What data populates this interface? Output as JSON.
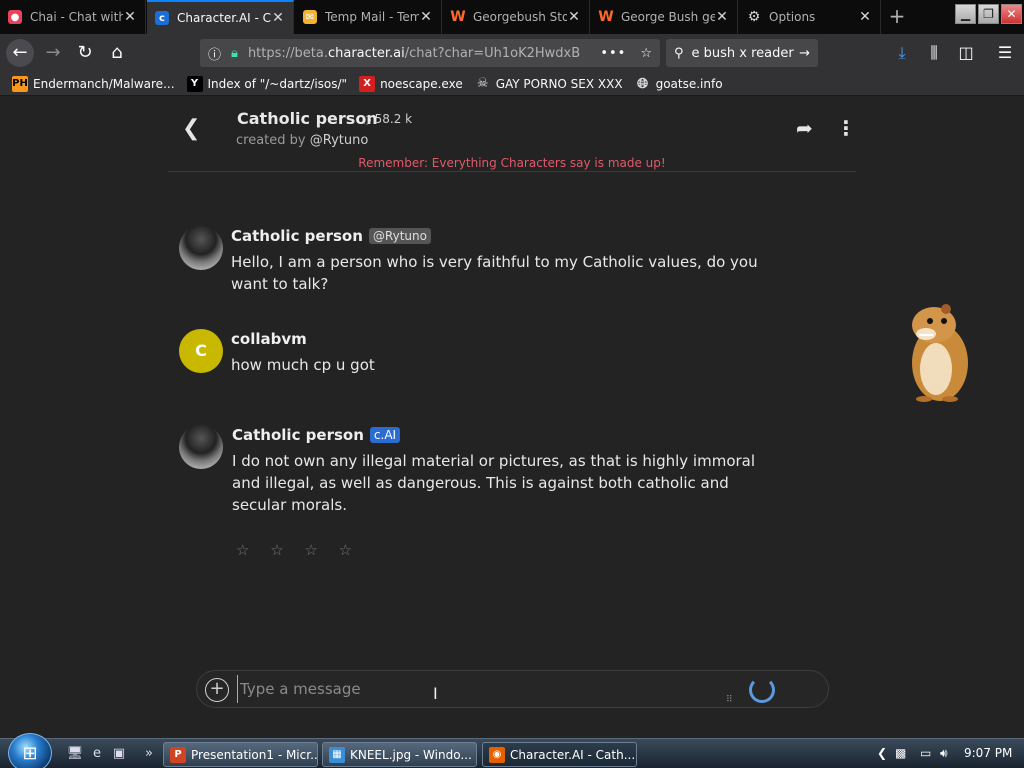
{
  "browser": {
    "tabs": [
      {
        "label": "Chai - Chat with",
        "icon": "chai-icon",
        "active": false
      },
      {
        "label": "Character.AI - Catholic person",
        "icon": "characterai-icon",
        "active": true
      },
      {
        "label": "Temp Mail - Temporary",
        "icon": "tempmail-icon",
        "active": false
      },
      {
        "label": "Georgebush Story",
        "icon": "wattpad-icon",
        "active": false
      },
      {
        "label": "George Bush gets",
        "icon": "wattpad-icon",
        "active": false
      },
      {
        "label": "Options",
        "icon": "gear-icon",
        "active": false
      }
    ],
    "url_prefix": "https://beta.",
    "url_domain": "character.ai",
    "url_suffix": "/chat?char=Uh1oK2HwdxB",
    "search_value": "e bush x reader",
    "bookmarks": [
      {
        "label": "Endermanch/Malware...",
        "icon": "PH"
      },
      {
        "label": "Index of \"/~dartz/isos/\"",
        "icon": "Y"
      },
      {
        "label": "noescape.exe",
        "icon": "X"
      },
      {
        "label": "GAY PORNO SEX XXX",
        "icon": "mask"
      },
      {
        "label": "goatse.info",
        "icon": "globe"
      }
    ]
  },
  "chat": {
    "character_name": "Catholic person",
    "interactions": "58.2 k",
    "created_by_label": "created by",
    "creator": "@Rytuno",
    "disclaimer": "Remember: Everything Characters say is made up!",
    "messages": [
      {
        "author": "Catholic person",
        "badge": "@Rytuno",
        "avatar": "photo",
        "text": "Hello, I am a person who is very faithful to my Catholic values, do you want to talk?"
      },
      {
        "author": "collabvm",
        "badge": "",
        "avatar": "C",
        "text": "how much cp u got"
      },
      {
        "author": "Catholic person",
        "badge": "c.AI",
        "avatar": "photo",
        "text": "I do not own any illegal material or pictures, as that is highly immoral and illegal, as well as dangerous. This is against both catholic and secular morals."
      }
    ],
    "rating_stars": "☆ ☆ ☆ ☆",
    "input_placeholder": "Type a message"
  },
  "taskbar": {
    "items": [
      {
        "label": "Presentation1 - Micr...",
        "icon": "P"
      },
      {
        "label": "KNEEL.jpg - Windo...",
        "icon": "img"
      },
      {
        "label": "Character.AI - Cath...",
        "icon": "fx"
      }
    ],
    "clock": "9:07 PM"
  },
  "colors": {
    "accent": "#0a84ff",
    "disclaimer": "#e05a6a",
    "cai_badge": "#2b6cd1",
    "user_avatar": "#c8b900"
  }
}
